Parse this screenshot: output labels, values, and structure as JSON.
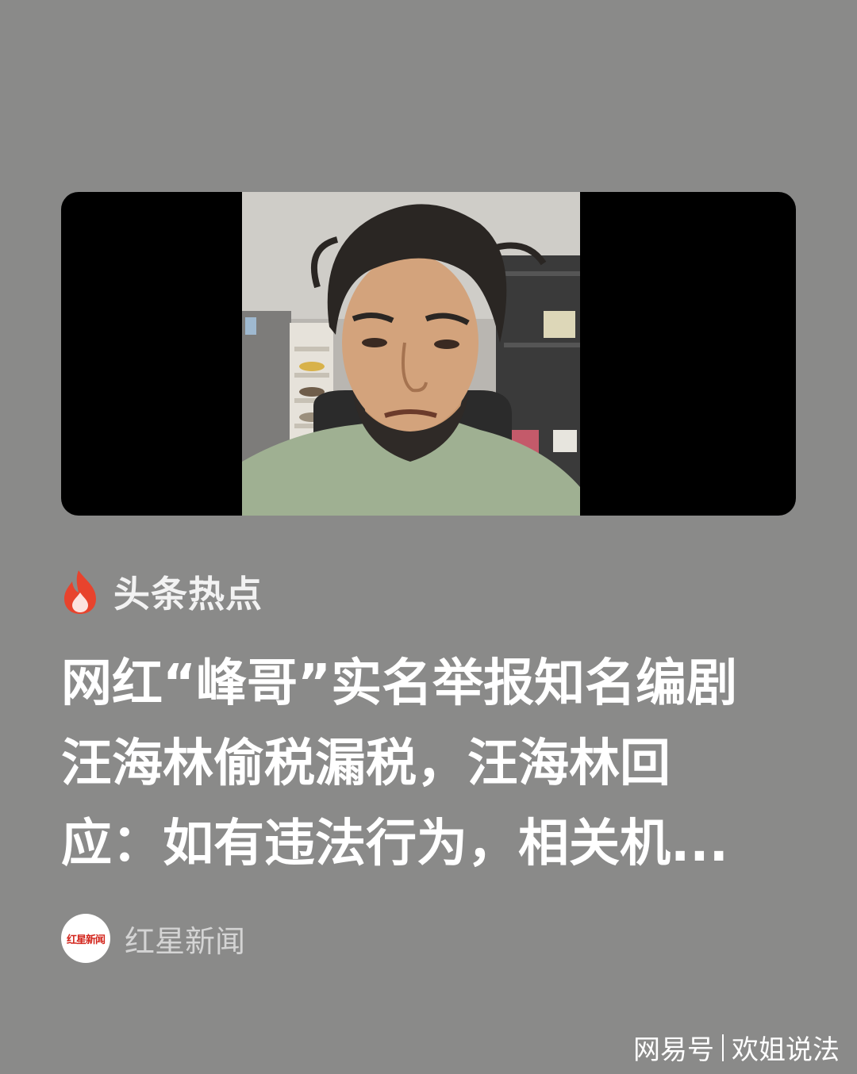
{
  "hot_section": {
    "label": "头条热点",
    "icon": "flame-icon",
    "accent": "#e8432d"
  },
  "article": {
    "headline": "网红“峰哥”实名举报知名编剧汪海林偷税漏税，汪海林回应：如有违法行为，相关机..."
  },
  "source": {
    "name": "红星新闻",
    "logo_text": "红星新闻"
  },
  "watermark": {
    "platform": "网易号",
    "account": "欢姐说法"
  },
  "colors": {
    "background": "#8a8a89",
    "headline": "#ffffff",
    "logo_red": "#d3261d"
  }
}
